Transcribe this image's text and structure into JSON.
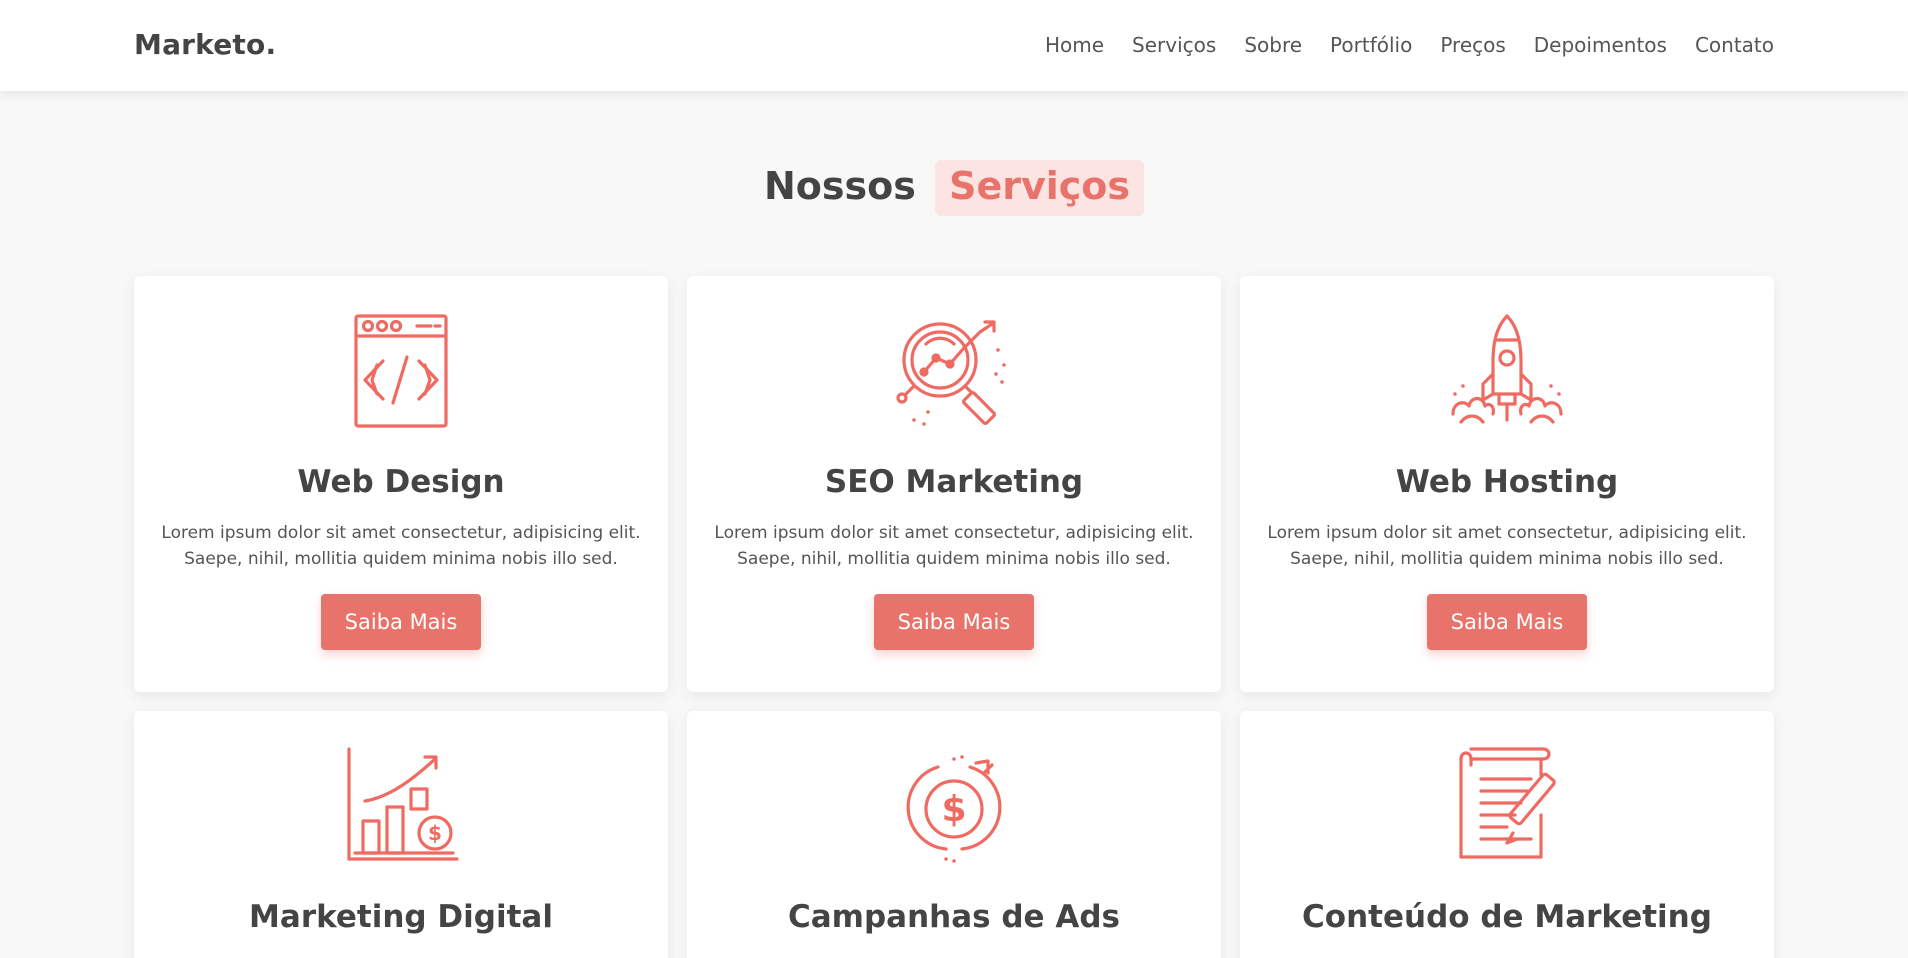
{
  "header": {
    "logo": "Marketo.",
    "nav": [
      "Home",
      "Serviços",
      "Sobre",
      "Portfólio",
      "Preços",
      "Depoimentos",
      "Contato"
    ]
  },
  "section": {
    "title_prefix": "Nossos",
    "title_highlight": "Serviços"
  },
  "colors": {
    "accent": "#e8736a",
    "highlight_bg": "#fbe4e2",
    "text": "#444444"
  },
  "services": [
    {
      "title": "Web Design",
      "icon": "code-window-icon",
      "text": "Lorem ipsum dolor sit amet consectetur, adipisicing elit. Saepe, nihil, mollitia quidem minima nobis illo sed.",
      "button": "Saiba Mais"
    },
    {
      "title": "SEO Marketing",
      "icon": "magnifier-chart-icon",
      "text": "Lorem ipsum dolor sit amet consectetur, adipisicing elit. Saepe, nihil, mollitia quidem minima nobis illo sed.",
      "button": "Saiba Mais"
    },
    {
      "title": "Web Hosting",
      "icon": "rocket-icon",
      "text": "Lorem ipsum dolor sit amet consectetur, adipisicing elit. Saepe, nihil, mollitia quidem minima nobis illo sed.",
      "button": "Saiba Mais"
    },
    {
      "title": "Marketing Digital",
      "icon": "growth-chart-icon"
    },
    {
      "title": "Campanhas de Ads",
      "icon": "dollar-cycle-icon"
    },
    {
      "title": "Conteúdo de Marketing",
      "icon": "document-pen-icon"
    }
  ]
}
